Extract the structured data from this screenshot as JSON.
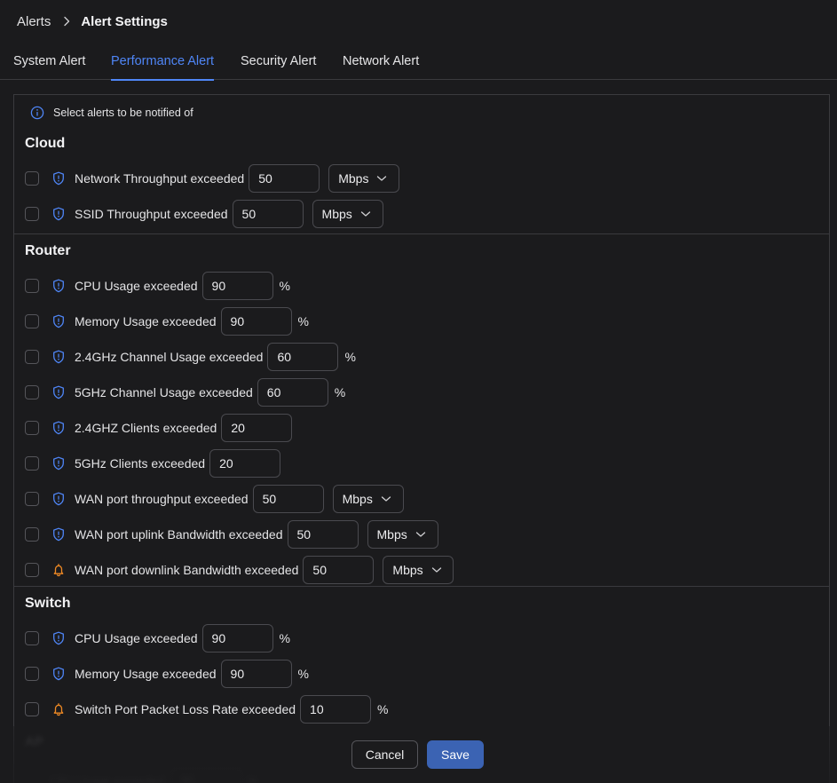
{
  "breadcrumb": {
    "root": "Alerts",
    "current": "Alert Settings"
  },
  "tabs": [
    {
      "label": "System Alert",
      "active": false
    },
    {
      "label": "Performance Alert",
      "active": true
    },
    {
      "label": "Security Alert",
      "active": false
    },
    {
      "label": "Network Alert",
      "active": false
    }
  ],
  "info_text": "Select alerts to be notified of",
  "icons": {
    "info": "info-circle-icon",
    "shield": "shield-alert-icon",
    "bell": "bell-icon",
    "chevron": "chevron-down-icon",
    "breadcrumb_separator": "chevron-right-icon"
  },
  "colors": {
    "accent": "#4f86f7",
    "shield": "#4f86f7",
    "bell": "#f08a24",
    "save_button": "#3b63b3",
    "background": "#1b1b1d"
  },
  "sections": [
    {
      "title": "Cloud",
      "rows": [
        {
          "icon": "shield",
          "label": "Network Throughput exceeded",
          "value": "50",
          "unit_type": "select",
          "unit": "Mbps"
        },
        {
          "icon": "shield",
          "label": "SSID Throughput exceeded",
          "value": "50",
          "unit_type": "select",
          "unit": "Mbps"
        }
      ]
    },
    {
      "title": "Router",
      "rows": [
        {
          "icon": "shield",
          "label": "CPU Usage exceeded",
          "value": "90",
          "unit_type": "text",
          "unit": "%"
        },
        {
          "icon": "shield",
          "label": "Memory Usage exceeded",
          "value": "90",
          "unit_type": "text",
          "unit": "%"
        },
        {
          "icon": "shield",
          "label": "2.4GHz Channel Usage exceeded",
          "value": "60",
          "unit_type": "text",
          "unit": "%"
        },
        {
          "icon": "shield",
          "label": "5GHz Channel Usage exceeded",
          "value": "60",
          "unit_type": "text",
          "unit": "%"
        },
        {
          "icon": "shield",
          "label": "2.4GHZ Clients exceeded",
          "value": "20",
          "unit_type": "none",
          "unit": ""
        },
        {
          "icon": "shield",
          "label": "5GHz Clients exceeded",
          "value": "20",
          "unit_type": "none",
          "unit": ""
        },
        {
          "icon": "shield",
          "label": "WAN port throughput exceeded",
          "value": "50",
          "unit_type": "select",
          "unit": "Mbps"
        },
        {
          "icon": "shield",
          "label": "WAN port uplink Bandwidth exceeded",
          "value": "50",
          "unit_type": "select",
          "unit": "Mbps"
        },
        {
          "icon": "bell",
          "label": "WAN port downlink Bandwidth exceeded",
          "value": "50",
          "unit_type": "select",
          "unit": "Mbps"
        }
      ]
    },
    {
      "title": "Switch",
      "rows": [
        {
          "icon": "shield",
          "label": "CPU Usage exceeded",
          "value": "90",
          "unit_type": "text",
          "unit": "%"
        },
        {
          "icon": "shield",
          "label": "Memory Usage exceeded",
          "value": "90",
          "unit_type": "text",
          "unit": "%"
        },
        {
          "icon": "bell",
          "label": "Switch Port Packet Loss Rate exceeded",
          "value": "10",
          "unit_type": "text",
          "unit": "%"
        }
      ]
    }
  ],
  "footer": {
    "cancel_label": "Cancel",
    "save_label": "Save"
  }
}
